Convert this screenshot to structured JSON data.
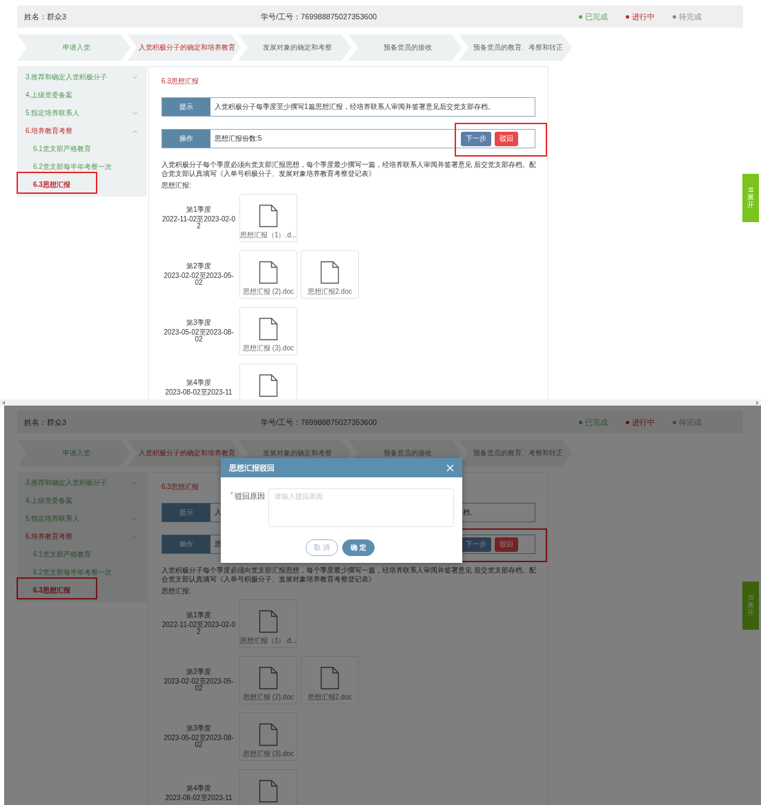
{
  "screens": [
    {
      "header": {
        "name": "姓名：群众3",
        "student_id": "学号/工号：769988875027353600",
        "legend": [
          {
            "label": "已完成",
            "kind": "done"
          },
          {
            "label": "进行中",
            "kind": "current"
          },
          {
            "label": "待完成",
            "kind": "pending"
          }
        ]
      },
      "steps": [
        {
          "label": "申请入党",
          "kind": "done"
        },
        {
          "label": "入党积极分子的确定和培养教育",
          "kind": "current"
        },
        {
          "label": "发展对象的确定和考察",
          "kind": "pending"
        },
        {
          "label": "预备党员的接收",
          "kind": "pending"
        },
        {
          "label": "预备党员的教育、考察和转正",
          "kind": "pending"
        }
      ],
      "sidebar": {
        "items": [
          {
            "label": "3.推荐和确定入党积极分子",
            "expanded": false
          },
          {
            "label": "4.上级党委备案"
          },
          {
            "label": "5.指定培养联系人",
            "expanded": false
          },
          {
            "label": "6.培养教育考察",
            "expanded": true,
            "children": [
              {
                "label": "6.1党支部严格教育",
                "selected": false,
                "annotated": false
              },
              {
                "label": "6.2党支部每半年考察一次",
                "selected": false,
                "annotated": false
              },
              {
                "label": "6.3思想汇报",
                "selected": true,
                "annotated": true
              }
            ]
          }
        ]
      },
      "content": {
        "title": "6.3思想汇报",
        "hint": {
          "label": "提示",
          "text": "入党积极分子每季度至少撰写1篇思想汇报，经培养联系人审阅并签署意见后交党支部存档。"
        },
        "operation": {
          "label": "操作",
          "text": "思想汇报份数:5",
          "buttons_annotated": true,
          "buttons": [
            {
              "label": "下一步",
              "kind": "primary"
            },
            {
              "label": "驳回",
              "kind": "danger"
            }
          ]
        },
        "description": "入党积极分子每个季度必须向党支部汇报思想，每个季度最少撰写一篇，经培养联系人审阅并签署意见 后交党支部存档。配合党支部认真填写《入单号积极分子、发展对象培养教育考察登记表》",
        "reports_label": "思想汇报:",
        "quarters": [
          {
            "name": "第1季度",
            "range": "2022-11-02至2023-02-02",
            "files": [
              {
                "name": "思想汇报（1）.d...",
                "kind": "doc"
              }
            ]
          },
          {
            "name": "第2季度",
            "range": "2023-02-02至2023-05-02",
            "files": [
              {
                "name": "思想汇报 (2).doc",
                "kind": "doc"
              },
              {
                "name": "思想汇报2.doc",
                "kind": "doc"
              }
            ]
          },
          {
            "name": "第3季度",
            "range": "2023-05-02至2023-08-02",
            "files": [
              {
                "name": "思想汇报 (3).doc",
                "kind": "doc"
              }
            ]
          },
          {
            "name": "第4季度",
            "range": "2023-08-02至2023-11",
            "files": [
              {
                "kind": "doc"
              }
            ]
          }
        ]
      },
      "side_tab": {
        "label": "展开"
      }
    },
    {
      "header": {
        "name": "姓名：群众3",
        "student_id": "学号/工号：769988875027353600",
        "legend": [
          {
            "label": "已完成",
            "kind": "done"
          },
          {
            "label": "进行中",
            "kind": "current"
          },
          {
            "label": "待完成",
            "kind": "pending"
          }
        ]
      },
      "steps": [
        {
          "label": "申请入党",
          "kind": "done"
        },
        {
          "label": "入党积极分子的确定和培养教育",
          "kind": "current"
        },
        {
          "label": "发展对象的确定和考察",
          "kind": "pending"
        },
        {
          "label": "预备党员的接收",
          "kind": "pending"
        },
        {
          "label": "预备党员的教育、考察和转正",
          "kind": "pending"
        }
      ],
      "sidebar": {
        "items": [
          {
            "label": "3.推荐和确定入党积极分子",
            "expanded": false
          },
          {
            "label": "4.上级党委备案"
          },
          {
            "label": "5.指定培养联系人",
            "expanded": false
          },
          {
            "label": "6.培养教育考察",
            "expanded": true,
            "children": [
              {
                "label": "6.1党支部严格教育",
                "selected": false,
                "annotated": false
              },
              {
                "label": "6.2党支部每半年考察一次",
                "selected": false,
                "annotated": false
              },
              {
                "label": "6.3思想汇报",
                "selected": true,
                "annotated": true
              }
            ]
          }
        ]
      },
      "content": {
        "title": "6.3思想汇报",
        "hint": {
          "label": "提示",
          "text_parts": [
            "入",
            "档。"
          ]
        },
        "operation": {
          "label": "操作",
          "text_parts": [
            "思"
          ],
          "buttons_annotated": true,
          "buttons": [
            {
              "label": "下一步",
              "kind": "primary"
            },
            {
              "label": "驳回",
              "kind": "danger"
            }
          ]
        },
        "description": "入党积极分子每个季度必须向党支部汇报思想，每个季度最少撰写一篇，经培养联系人审阅并签署意见 后交党支部存档。配合党支部认真填写《入单号积极分子、发展对象培养教育考察登记表》",
        "reports_label": "思想汇报:",
        "quarters": [
          {
            "name": "第1季度",
            "range": "2022-11-02至2023-02-02",
            "files": [
              {
                "name": "思想汇报（1）.d...",
                "kind": "doc"
              }
            ]
          },
          {
            "name": "第2季度",
            "range": "2023-02-02至2023-05-02",
            "files": [
              {
                "name": "思想汇报 (2).doc",
                "kind": "doc"
              },
              {
                "name": "思想汇报2.doc",
                "kind": "doc"
              }
            ]
          },
          {
            "name": "第3季度",
            "range": "2023-05-02至2023-08-02",
            "files": [
              {
                "name": "思想汇报 (3).doc",
                "kind": "doc"
              }
            ]
          },
          {
            "name": "第4季度",
            "range": "2023-08-02至2023-11",
            "files": [
              {
                "kind": "doc"
              }
            ]
          }
        ]
      },
      "side_tab": {
        "label": "展开"
      },
      "dialog": {
        "title": "思想汇报驳回",
        "required_mark": "*",
        "field_label": "驳回原因",
        "placeholder": "请输入驳回原因",
        "buttons": [
          {
            "label": "取 消",
            "kind": "secondary"
          },
          {
            "label": "确 定",
            "kind": "primary"
          }
        ]
      }
    }
  ]
}
